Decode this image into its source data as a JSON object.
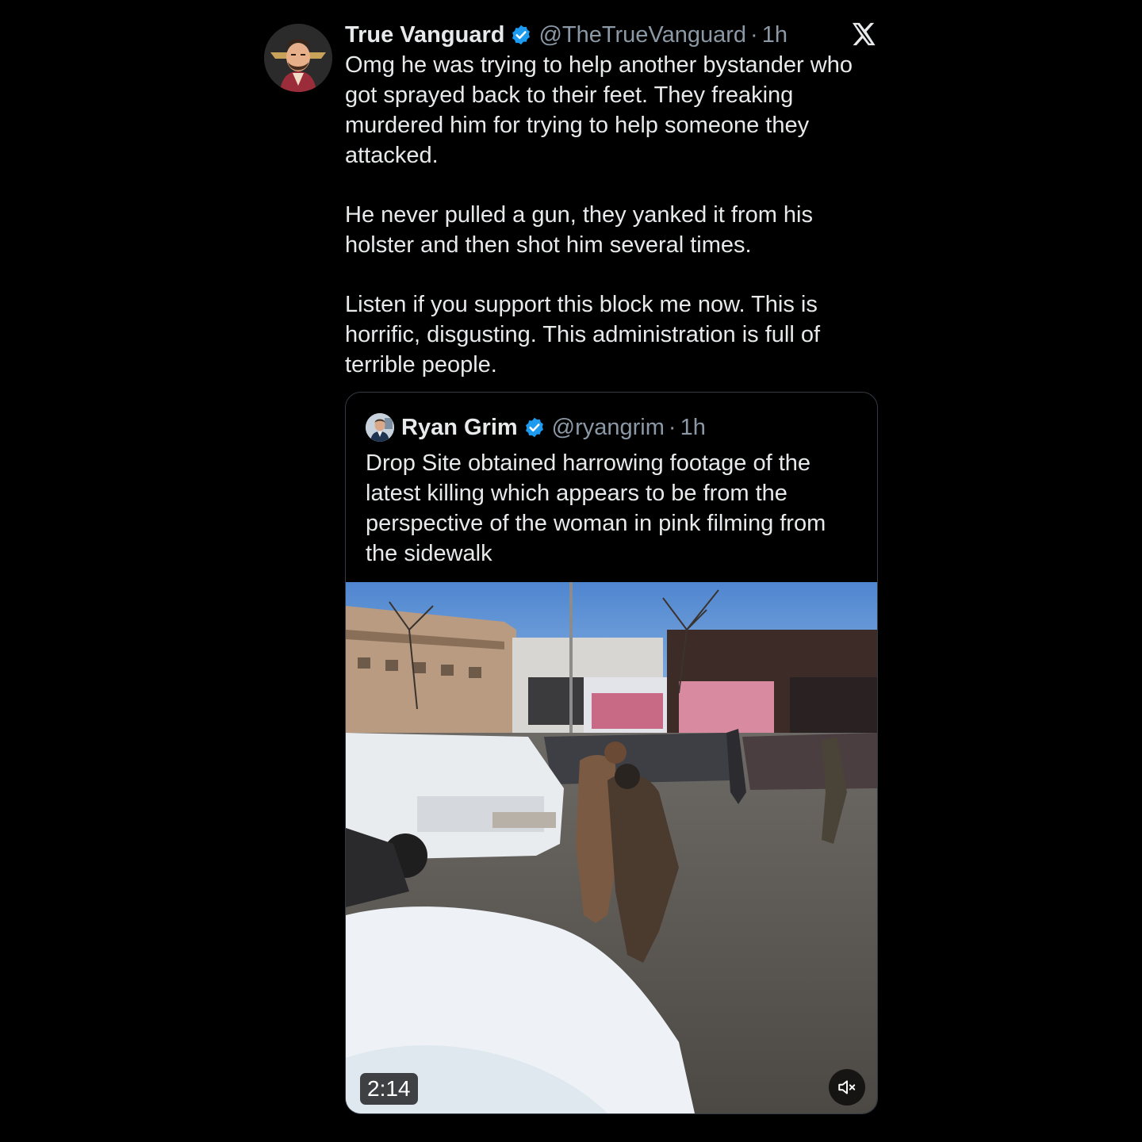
{
  "tweet": {
    "author_name": "True Vanguard",
    "author_handle": "@TheTrueVanguard",
    "separator": "·",
    "time": "1h",
    "paragraphs": [
      "Omg he was trying to help another bystander who got sprayed back to their feet. They freaking murdered him for trying to help someone they attacked.",
      "He never pulled a gun, they yanked it from his holster and then shot him several times.",
      "Listen if you support this block me now. This is horrific, disgusting.  This administration is full of terrible people."
    ],
    "verified": true
  },
  "quoted_tweet": {
    "author_name": "Ryan Grim",
    "author_handle": "@ryangrim",
    "separator": "·",
    "time": "1h",
    "text": "Drop Site obtained harrowing footage of the latest killing which appears to be from the perspective of the woman in pink filming from the sidewalk",
    "verified": true,
    "video": {
      "duration": "2:14",
      "muted": true
    }
  },
  "icons": {
    "brand": "x-logo-icon",
    "verified": "verified-badge-icon",
    "mute": "speaker-muted-icon"
  },
  "colors": {
    "background": "#000000",
    "text": "#e7e9ea",
    "secondary_text": "#8b98a5",
    "verified_blue": "#1d9bf0",
    "border": "#333a41"
  }
}
